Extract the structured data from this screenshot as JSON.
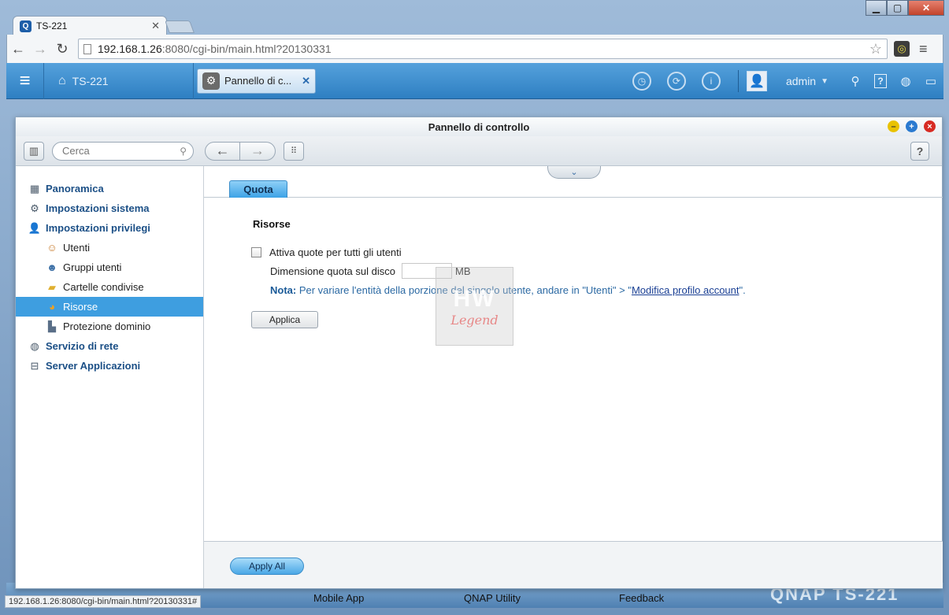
{
  "browser": {
    "tab_title": "TS-221",
    "url_host": "192.168.1.26",
    "url_rest": ":8080/cgi-bin/main.html?20130331",
    "status_url": "192.168.1.26:8080/cgi-bin/main.html?20130331#"
  },
  "qts_bar": {
    "device_name": "TS-221",
    "app_tab_label": "Pannello di c...",
    "user": "admin"
  },
  "desktop": {
    "items": [
      "Mobile App",
      "QNAP Utility",
      "Feedback"
    ],
    "brand": "QNAP TS-221"
  },
  "window": {
    "title": "Pannello di controllo",
    "search_placeholder": "Cerca"
  },
  "sidebar": {
    "items": [
      {
        "label": "Panoramica",
        "level": "top",
        "icon": "overview-icon"
      },
      {
        "label": "Impostazioni sistema",
        "level": "top",
        "icon": "gear-icon"
      },
      {
        "label": "Impostazioni privilegi",
        "level": "top",
        "icon": "user-icon"
      },
      {
        "label": "Utenti",
        "level": "sub",
        "icon": "user-icon"
      },
      {
        "label": "Gruppi utenti",
        "level": "sub",
        "icon": "group-icon"
      },
      {
        "label": "Cartelle condivise",
        "level": "sub",
        "icon": "folder-icon"
      },
      {
        "label": "Risorse",
        "level": "sub",
        "icon": "quota-icon",
        "active": true
      },
      {
        "label": "Protezione dominio",
        "level": "sub",
        "icon": "domain-icon"
      },
      {
        "label": "Servizio di rete",
        "level": "top",
        "icon": "network-icon"
      },
      {
        "label": "Server Applicazioni",
        "level": "top",
        "icon": "server-icon"
      }
    ]
  },
  "main": {
    "tab_label": "Quota",
    "section_title": "Risorse",
    "enable_quota_label": "Attiva quote per tutti gli utenti",
    "enable_quota_checked": false,
    "quota_size_label": "Dimensione quota sul disco",
    "quota_size_value": "",
    "quota_unit": "MB",
    "note_prefix": "Nota:",
    "note_text": " Per variare l'entità della porzione del singolo utente, andare in \"Utenti\" > \"",
    "note_link": "Modifica profilo account",
    "note_suffix": "\".",
    "apply_label": "Applica",
    "apply_all_label": "Apply All"
  },
  "watermark": {
    "line1": "HW",
    "line2": "Legend"
  }
}
